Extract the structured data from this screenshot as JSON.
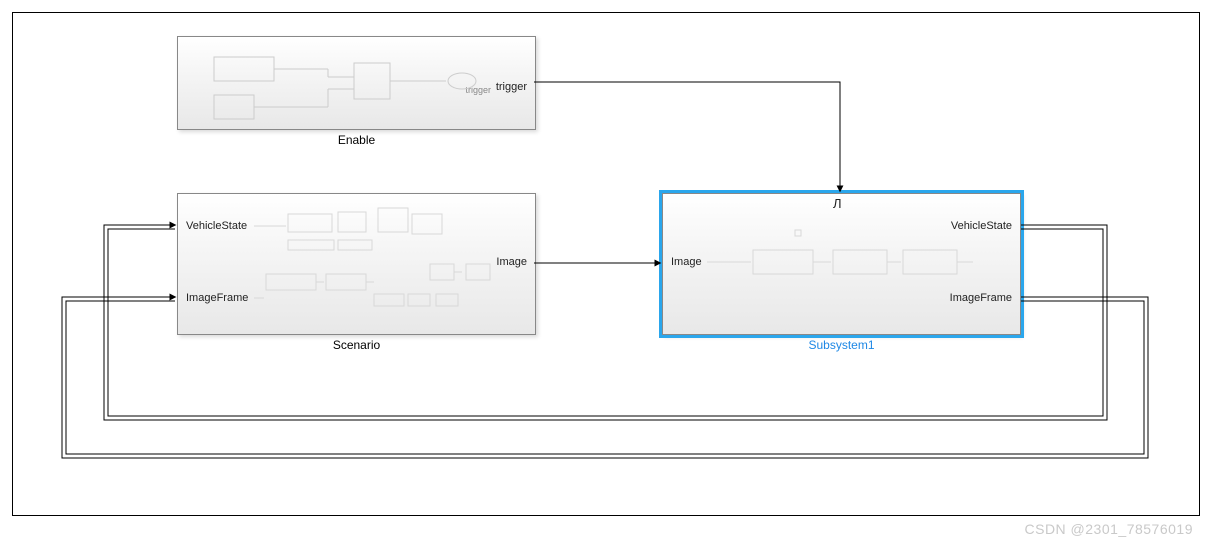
{
  "blocks": {
    "enable": {
      "label": "Enable",
      "ports": {
        "out": "trigger",
        "out_tiny": "trigger"
      }
    },
    "scenario": {
      "label": "Scenario",
      "ports": {
        "in1": "VehicleState",
        "in2": "ImageFrame",
        "out": "Image"
      }
    },
    "subsystem1": {
      "label": "Subsystem1",
      "ports": {
        "in": "Image",
        "out1": "VehicleState",
        "out2": "ImageFrame"
      }
    }
  },
  "trigger_glyph": "Л",
  "watermark": "CSDN @2301_78576019"
}
